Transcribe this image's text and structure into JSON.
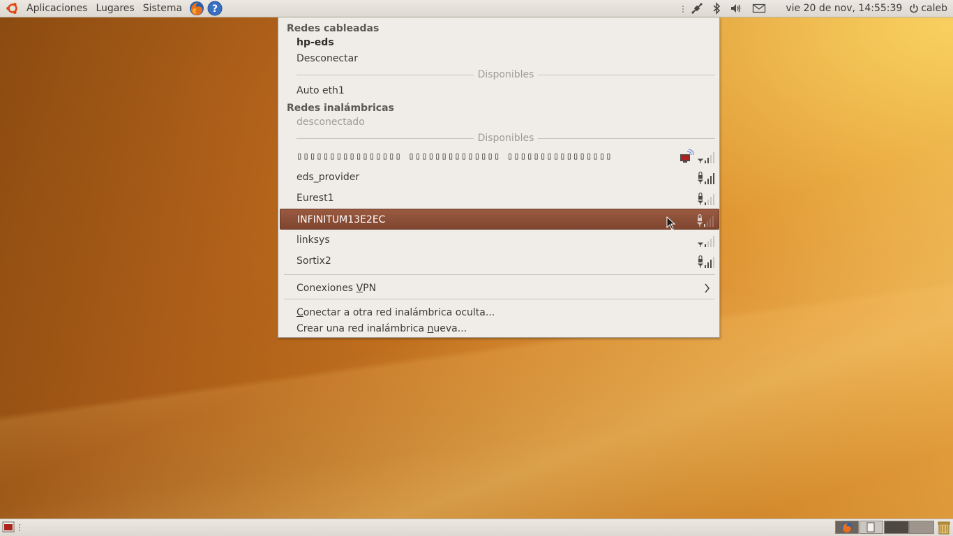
{
  "top_panel": {
    "menus": [
      "Aplicaciones",
      "Lugares",
      "Sistema"
    ],
    "clock": "vie 20 de nov, 14:55:39",
    "user": "caleb",
    "tray_icons": [
      "network-wired-icon",
      "bluetooth-icon",
      "volume-icon",
      "mail-icon",
      "power-icon"
    ]
  },
  "network_menu": {
    "wired_header": "Redes cableadas",
    "wired_active": "hp-eds",
    "disconnect": "Desconectar",
    "available_label": "Disponibles",
    "wired_available": "Auto eth1",
    "wireless_header": "Redes inalámbricas",
    "wireless_status": "desconectado",
    "wireless_available_label": "Disponibles",
    "networks": [
      {
        "name": "▯▯▯▯▯▯▯▯▯▯▯▯▯▯▯▯ ▯▯▯▯▯▯▯▯▯▯▯▯▯▯ ▯▯▯▯▯▯▯▯▯▯▯▯▯▯▯▯",
        "locked": false,
        "signal": 2,
        "adhoc": true
      },
      {
        "name": "eds_provider",
        "locked": true,
        "signal": 4
      },
      {
        "name": "Eurest1",
        "locked": true,
        "signal": 1
      },
      {
        "name": "INFINITUM13E2EC",
        "locked": true,
        "signal": 1,
        "highlighted": true
      },
      {
        "name": "linksys",
        "locked": false,
        "signal": 1
      },
      {
        "name": "Sortix2",
        "locked": true,
        "signal": 3
      }
    ],
    "vpn": {
      "pre": "Conexiones ",
      "mnemonic": "V",
      "post": "PN"
    },
    "hidden": {
      "pre": "",
      "mnemonic": "C",
      "post": "onectar a otra red inalámbrica oculta..."
    },
    "create": {
      "pre": "Crear una red inalámbrica ",
      "mnemonic": "n",
      "post": "ueva..."
    }
  },
  "colors": {
    "highlight": "#8a4e36",
    "panel": "#e4e0da",
    "accent": "#dd8c2a"
  }
}
